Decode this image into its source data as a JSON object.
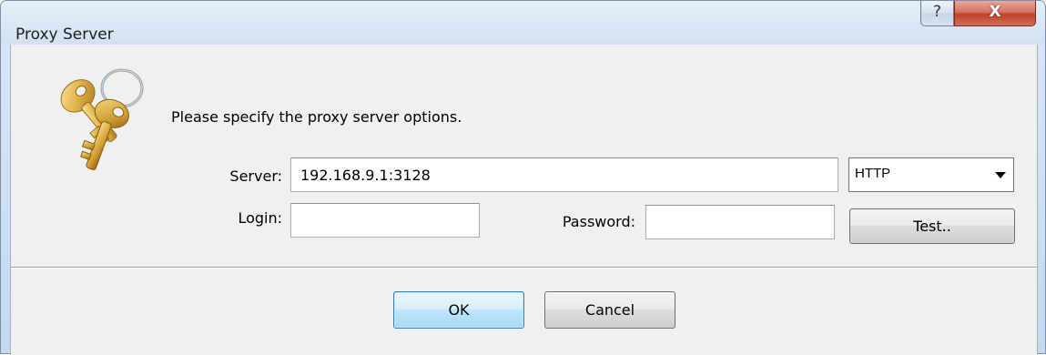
{
  "window": {
    "title": "Proxy Server",
    "help_glyph": "?",
    "close_glyph": "X"
  },
  "dialog": {
    "icon": "keys-icon",
    "prompt": "Please specify the proxy server options.",
    "server_label": "Server:",
    "server_value": "192.168.9.1:3128",
    "protocol_selected": "HTTP",
    "login_label": "Login:",
    "login_value": "",
    "password_label": "Password:",
    "password_value": "",
    "test_button": "Test..",
    "ok_button": "OK",
    "cancel_button": "Cancel"
  },
  "colors": {
    "close_button": "#c2402a",
    "default_button_border": "#3c7fb1",
    "client_background": "#f0f0f0"
  }
}
